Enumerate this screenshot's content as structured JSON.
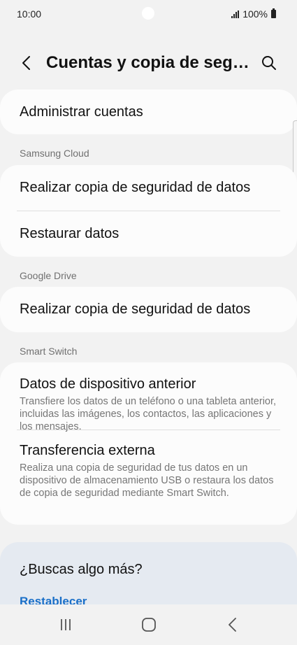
{
  "status_bar": {
    "time": "10:00",
    "battery": "100%"
  },
  "header": {
    "title": "Cuentas y copia de segur...",
    "back_icon": "chevron-left-icon",
    "search_icon": "search-icon"
  },
  "accounts": {
    "manage_label": "Administrar cuentas"
  },
  "samsung_cloud": {
    "section_label": "Samsung Cloud",
    "backup_label": "Realizar copia de seguridad de datos",
    "restore_label": "Restaurar datos"
  },
  "google_drive": {
    "section_label": "Google Drive",
    "backup_label": "Realizar copia de seguridad de datos"
  },
  "smart_switch": {
    "section_label": "Smart Switch",
    "items": [
      {
        "title": "Datos de dispositivo anterior",
        "description": "Transfiere los datos de un teléfono o una tableta anterior, incluidas las imágenes, los contactos, las aplicaciones y los mensajes."
      },
      {
        "title": "Transferencia externa",
        "description": "Realiza una copia de seguridad de tus datos en un dispositivo de almacenamiento USB o restaura los datos de copia de seguridad mediante Smart Switch."
      }
    ]
  },
  "looking_for_more": {
    "title": "¿Buscas algo más?",
    "link_label": "Restablecer"
  },
  "nav_bar": {
    "recents_icon": "recents-icon",
    "home_icon": "home-icon",
    "back_icon": "back-icon"
  }
}
